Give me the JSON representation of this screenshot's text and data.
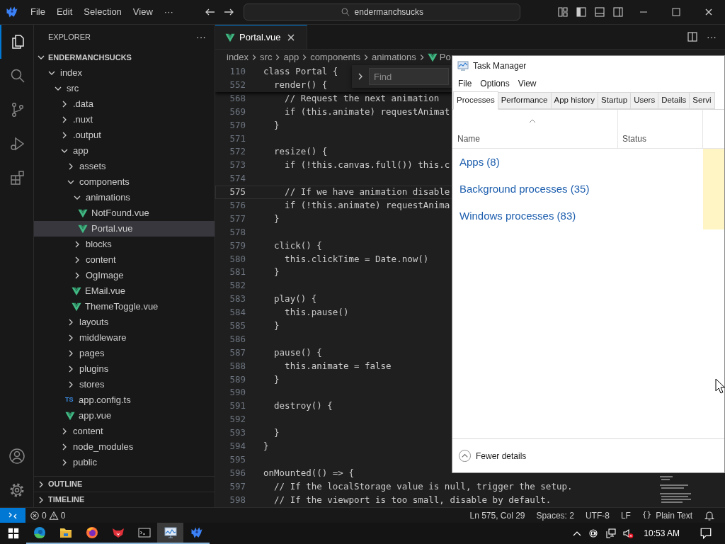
{
  "titlebar": {
    "menus": [
      "File",
      "Edit",
      "Selection",
      "View",
      "···"
    ],
    "command_center": "endermanchsucks"
  },
  "activity_bar": {
    "items": [
      {
        "kind": "files",
        "selected": true
      },
      {
        "kind": "search",
        "selected": false
      },
      {
        "kind": "scm",
        "selected": false
      },
      {
        "kind": "debug",
        "selected": false
      },
      {
        "kind": "extensions",
        "selected": false
      }
    ]
  },
  "sidebar": {
    "title": "EXPLORER",
    "more": "···",
    "root": {
      "label": "ENDERMANCHSUCKS",
      "expanded": true,
      "children": [
        {
          "label": "index",
          "kind": "folder",
          "expanded": true,
          "selected": false,
          "children": [
            {
              "label": "src",
              "kind": "folder",
              "expanded": true,
              "selected": false,
              "children": [
                {
                  "label": ".data",
                  "kind": "folder",
                  "expanded": false,
                  "selected": false
                },
                {
                  "label": ".nuxt",
                  "kind": "folder",
                  "expanded": false,
                  "selected": false
                },
                {
                  "label": ".output",
                  "kind": "folder",
                  "expanded": false,
                  "selected": false
                },
                {
                  "label": "app",
                  "kind": "folder",
                  "expanded": true,
                  "selected": false,
                  "children": [
                    {
                      "label": "assets",
                      "kind": "folder",
                      "expanded": false,
                      "selected": false
                    },
                    {
                      "label": "components",
                      "kind": "folder",
                      "expanded": true,
                      "selected": false,
                      "children": [
                        {
                          "label": "animations",
                          "kind": "folder",
                          "expanded": true,
                          "selected": false,
                          "children": [
                            {
                              "label": "NotFound.vue",
                              "kind": "vue",
                              "selected": false
                            },
                            {
                              "label": "Portal.vue",
                              "kind": "vue",
                              "selected": true
                            }
                          ]
                        },
                        {
                          "label": "blocks",
                          "kind": "folder",
                          "expanded": false,
                          "selected": false
                        },
                        {
                          "label": "content",
                          "kind": "folder",
                          "expanded": false,
                          "selected": false
                        },
                        {
                          "label": "OgImage",
                          "kind": "folder",
                          "expanded": false,
                          "selected": false
                        },
                        {
                          "label": "EMail.vue",
                          "kind": "vue",
                          "selected": false
                        },
                        {
                          "label": "ThemeToggle.vue",
                          "kind": "vue",
                          "selected": false
                        }
                      ]
                    },
                    {
                      "label": "layouts",
                      "kind": "folder",
                      "expanded": false,
                      "selected": false
                    },
                    {
                      "label": "middleware",
                      "kind": "folder",
                      "expanded": false,
                      "selected": false
                    },
                    {
                      "label": "pages",
                      "kind": "folder",
                      "expanded": false,
                      "selected": false
                    },
                    {
                      "label": "plugins",
                      "kind": "folder",
                      "expanded": false,
                      "selected": false
                    },
                    {
                      "label": "stores",
                      "kind": "folder",
                      "expanded": false,
                      "selected": false
                    },
                    {
                      "label": "app.config.ts",
                      "kind": "ts",
                      "badge": "TS",
                      "selected": false
                    },
                    {
                      "label": "app.vue",
                      "kind": "vue",
                      "selected": false
                    }
                  ]
                },
                {
                  "label": "content",
                  "kind": "folder",
                  "expanded": false,
                  "selected": false
                },
                {
                  "label": "node_modules",
                  "kind": "folder",
                  "expanded": false,
                  "selected": false
                },
                {
                  "label": "public",
                  "kind": "folder",
                  "expanded": false,
                  "selected": false
                }
              ]
            }
          ]
        }
      ]
    },
    "sections": [
      {
        "label": "OUTLINE",
        "expanded": false
      },
      {
        "label": "TIMELINE",
        "expanded": false
      }
    ]
  },
  "editor": {
    "tabs": [
      {
        "label": "Portal.vue",
        "selected": true
      }
    ],
    "more": "···",
    "breadcrumb": [
      {
        "label": "index"
      },
      {
        "label": "src"
      },
      {
        "label": "app"
      },
      {
        "label": "components"
      },
      {
        "label": "animations"
      },
      {
        "label": "Po",
        "kind": "vue"
      }
    ],
    "find": {
      "placeholder": "Find"
    },
    "sticky_lines": [
      {
        "number": "110",
        "text": "class Portal {"
      },
      {
        "number": "552",
        "text": "  render() {"
      }
    ],
    "lines": [
      {
        "number": "568",
        "text": "    // Request the next animation",
        "current": false
      },
      {
        "number": "569",
        "text": "    if (this.animate) requestAnimat",
        "current": false
      },
      {
        "number": "570",
        "text": "  }",
        "current": false
      },
      {
        "number": "571",
        "current": false
      },
      {
        "number": "572",
        "text": "  resize() {",
        "current": false
      },
      {
        "number": "573",
        "text": "    if (!this.canvas.full()) this.c",
        "current": false
      },
      {
        "number": "574",
        "current": false
      },
      {
        "number": "575",
        "text": "    // If we have animation disable",
        "current": true
      },
      {
        "number": "576",
        "text": "    if (!this.animate) requestAnima",
        "current": false
      },
      {
        "number": "577",
        "text": "  }",
        "current": false
      },
      {
        "number": "578",
        "current": false
      },
      {
        "number": "579",
        "text": "  click() {",
        "current": false
      },
      {
        "number": "580",
        "text": "    this.clickTime = Date.now()",
        "current": false
      },
      {
        "number": "581",
        "text": "  }",
        "current": false
      },
      {
        "number": "582",
        "current": false
      },
      {
        "number": "583",
        "text": "  play() {",
        "current": false
      },
      {
        "number": "584",
        "text": "    this.pause()",
        "current": false
      },
      {
        "number": "585",
        "text": "  }",
        "current": false
      },
      {
        "number": "586",
        "current": false
      },
      {
        "number": "587",
        "text": "  pause() {",
        "current": false
      },
      {
        "number": "588",
        "text": "    this.animate = false",
        "current": false
      },
      {
        "number": "589",
        "text": "  }",
        "current": false
      },
      {
        "number": "590",
        "current": false
      },
      {
        "number": "591",
        "text": "  destroy() {",
        "current": false
      },
      {
        "number": "592",
        "current": false
      },
      {
        "number": "593",
        "text": "  }",
        "current": false
      },
      {
        "number": "594",
        "text": "}",
        "current": false
      },
      {
        "number": "595",
        "current": false
      },
      {
        "number": "596",
        "text": "onMounted(() => {",
        "current": false
      },
      {
        "number": "597",
        "text": "  // If the localStorage value is null, trigger the setup.",
        "current": false
      },
      {
        "number": "598",
        "text": "  // If the viewport is too small, disable by default.",
        "current": false
      }
    ]
  },
  "status_bar": {
    "errors": "0",
    "warnings": "0",
    "items": [
      "Ln 575, Col 29",
      "Spaces: 2",
      "UTF-8",
      "LF"
    ],
    "language_icon": "{}",
    "language": "Plain Text"
  },
  "task_manager": {
    "title": "Task Manager",
    "menus": [
      "File",
      "Options",
      "View"
    ],
    "tabs": [
      {
        "label": "Processes",
        "selected": true
      },
      {
        "label": "Performance",
        "selected": false
      },
      {
        "label": "App history",
        "selected": false
      },
      {
        "label": "Startup",
        "selected": false
      },
      {
        "label": "Users",
        "selected": false
      },
      {
        "label": "Details",
        "selected": false
      },
      {
        "label": "Servi",
        "selected": false
      }
    ],
    "columns": [
      "Name",
      "Status"
    ],
    "groups": [
      "Apps (8)",
      "Background processes (35)",
      "Windows processes (83)"
    ],
    "footer": "Fewer details"
  },
  "taskbar": {
    "apps": [
      {
        "kind": "edge",
        "selected": false
      },
      {
        "kind": "explorer",
        "selected": false
      },
      {
        "kind": "firefox",
        "selected": false
      },
      {
        "kind": "redapp",
        "selected": false
      },
      {
        "kind": "terminal",
        "selected": false
      },
      {
        "kind": "taskmanager",
        "selected": true
      },
      {
        "kind": "editor",
        "selected": false
      }
    ],
    "clock": "10:53 AM"
  }
}
